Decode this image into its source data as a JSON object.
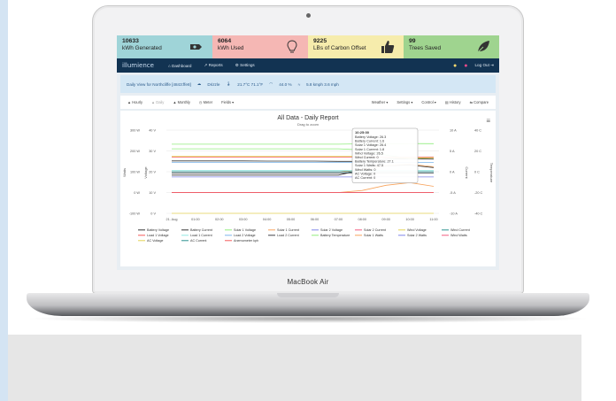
{
  "stats": [
    {
      "value": "10633",
      "label": "kWh Generated",
      "icon": "battery-plug-icon",
      "color": "#9fd4d8"
    },
    {
      "value": "6064",
      "label": "kWh Used",
      "icon": "lightbulb-icon",
      "color": "#f5b7b4"
    },
    {
      "value": "9225",
      "label": "LBs of Carbon Offset",
      "icon": "thumbs-up-icon",
      "color": "#f6ecac"
    },
    {
      "value": "99",
      "label": "Trees Saved",
      "icon": "leaf-icon",
      "color": "#9fd48f"
    }
  ],
  "nav": {
    "logo": "illumience",
    "links": [
      "Dashboard",
      "Reports",
      "Settings"
    ],
    "logout": "Log Out"
  },
  "weather": {
    "view": "Daily View for Northcliffe [4843:ffe8]",
    "condition": "Drizzle",
    "temp": "21.7°C 71.1°F",
    "humidity": "44.0 %",
    "wind": "5.8 kmph 3.6 mph"
  },
  "toolbar": {
    "left": [
      "Hourly",
      "Daily",
      "Monthly",
      "Meter",
      "Fields"
    ],
    "right": [
      "Weather",
      "Settings",
      "Control",
      "History",
      "Compare"
    ]
  },
  "chart_data": {
    "type": "line",
    "title": "All Data - Daily Report",
    "subtitle": "Drag to zoom",
    "x_ticks": [
      "21. Aug",
      "01:00",
      "02:00",
      "03:00",
      "04:00",
      "05:00",
      "06:00",
      "07:00",
      "08:00",
      "09:00",
      "10:00",
      "11:00"
    ],
    "y_axes": {
      "watts": {
        "label": "Watts",
        "ticks": [
          "300 W",
          "200 W",
          "100 W",
          "0 W",
          "-100 W"
        ],
        "range": [
          -100,
          300
        ]
      },
      "voltage": {
        "label": "Voltage",
        "ticks": [
          "40 V",
          "30 V",
          "20 V",
          "10 V",
          "0 V"
        ],
        "range": [
          0,
          40
        ]
      },
      "current": {
        "label": "Current",
        "ticks": [
          "10 A",
          "5 A",
          "0 A",
          "-5 A",
          "-10 A"
        ],
        "range": [
          -10,
          10
        ]
      },
      "temperature": {
        "label": "Temperature",
        "ticks": [
          "40 C",
          "20 C",
          "0 C",
          "-20 C",
          "-40 C"
        ],
        "range": [
          -40,
          40
        ]
      }
    },
    "series": [
      {
        "name": "Battery Voltage",
        "color": "#333333",
        "axis": "voltage",
        "values": [
          25.2,
          25.2,
          25.2,
          25.2,
          25.1,
          25.1,
          25.1,
          25.0,
          25.0,
          26.0,
          26.3,
          26.1
        ]
      },
      {
        "name": "Battery Current",
        "color": "#333333",
        "axis": "current",
        "values": [
          -0.8,
          -0.8,
          -0.8,
          -0.8,
          -0.8,
          -0.8,
          -0.8,
          -0.8,
          0.5,
          1.4,
          1.6,
          1.0
        ]
      },
      {
        "name": "Solar 1 Voltage",
        "color": "#90ed7d",
        "axis": "voltage",
        "values": [
          31.0,
          31.0,
          31.0,
          31.0,
          31.0,
          31.0,
          31.0,
          31.0,
          30.5,
          28.0,
          26.4,
          27.0
        ]
      },
      {
        "name": "Solar 1 Current",
        "color": "#f7a35c",
        "axis": "current",
        "values": [
          0,
          0,
          0,
          0,
          0,
          0,
          0,
          0,
          0.5,
          1.5,
          1.8,
          1.2
        ]
      },
      {
        "name": "Solar 2 Voltage",
        "color": "#8085e9",
        "axis": "voltage",
        "values": [
          17.5,
          17.5,
          17.5,
          17.5,
          17.5,
          17.5,
          17.5,
          17.5,
          17.5,
          17.5,
          17.5,
          17.5
        ]
      },
      {
        "name": "Solar 2 Current",
        "color": "#f15c80",
        "axis": "current",
        "values": [
          0,
          0,
          0,
          0,
          0,
          0,
          0,
          0,
          0,
          0,
          0,
          0
        ]
      },
      {
        "name": "Wind Voltage",
        "color": "#e4d354",
        "axis": "voltage",
        "values": [
          27.5,
          27.5,
          27.5,
          27.5,
          27.5,
          27.5,
          27.5,
          27.5,
          27.5,
          26.8,
          26.5,
          26.6
        ]
      },
      {
        "name": "Wind Current",
        "color": "#2b908f",
        "axis": "current",
        "values": [
          0,
          0,
          0,
          0,
          0,
          0,
          0,
          0,
          0,
          0,
          0,
          0
        ]
      },
      {
        "name": "Load 1 Voltage",
        "color": "#f45b5b",
        "axis": "voltage",
        "values": [
          27.0,
          27.0,
          27.0,
          27.0,
          27.0,
          27.0,
          27.0,
          27.0,
          27.0,
          27.0,
          27.0,
          27.0
        ]
      },
      {
        "name": "Load 1 Current",
        "color": "#91e8e1",
        "axis": "current",
        "values": [
          0.3,
          0.3,
          0.3,
          0.3,
          0.3,
          0.3,
          0.3,
          0.3,
          0.3,
          0.3,
          0.3,
          0.3
        ]
      },
      {
        "name": "Load 2 Voltage",
        "color": "#7cb5ec",
        "axis": "voltage",
        "values": [
          24.5,
          24.5,
          24.5,
          24.5,
          24.5,
          24.5,
          24.5,
          24.5,
          24.5,
          24.5,
          24.5,
          24.5
        ]
      },
      {
        "name": "Load 2 Current",
        "color": "#434348",
        "axis": "current",
        "values": [
          -0.3,
          -0.3,
          -0.3,
          -0.3,
          -0.3,
          -0.3,
          -0.3,
          -0.3,
          -0.3,
          -0.3,
          -0.3,
          -0.3
        ]
      },
      {
        "name": "Battery Temperature",
        "color": "#90ed7d",
        "axis": "temperature",
        "values": [
          26.5,
          26.5,
          26.5,
          26.5,
          26.5,
          26.5,
          26.5,
          26.5,
          26.8,
          27.0,
          27.1,
          27.0
        ]
      },
      {
        "name": "Solar 1 Watts",
        "color": "#f7a35c",
        "axis": "watts",
        "values": [
          0,
          0,
          0,
          0,
          0,
          0,
          0,
          0,
          10,
          35,
          47.5,
          30
        ]
      },
      {
        "name": "Solar 2 Watts",
        "color": "#8085e9",
        "axis": "watts",
        "values": [
          0,
          0,
          0,
          0,
          0,
          0,
          0,
          0,
          0,
          0,
          0,
          0
        ]
      },
      {
        "name": "Wind Watts",
        "color": "#f15c80",
        "axis": "watts",
        "values": [
          0,
          0,
          0,
          0,
          0,
          0,
          0,
          0,
          0,
          0,
          0,
          0
        ]
      },
      {
        "name": "AC Voltage",
        "color": "#e4d354",
        "axis": "voltage",
        "values": [
          0,
          0,
          0,
          0,
          0,
          0,
          0,
          0,
          0,
          0,
          0,
          0
        ]
      },
      {
        "name": "AC Current",
        "color": "#2b908f",
        "axis": "current",
        "values": [
          0,
          0,
          0,
          0,
          0,
          0,
          0,
          0,
          0,
          0,
          0,
          0
        ]
      },
      {
        "name": "Anemometer kph",
        "color": "#f45b5b",
        "axis": "watts",
        "values": [
          0,
          0,
          0,
          0,
          0,
          0,
          0,
          0,
          0,
          0,
          0,
          0
        ]
      }
    ],
    "tooltip": {
      "time": "10:25:00",
      "lines": [
        "Battery Voltage: 26.3",
        "Battery Current: 1.6",
        "Solar 1 Voltage: 26.4",
        "Solar 1 Current: 1.8",
        "Wind Voltage: 26.5",
        "Wind Current: 0",
        "Battery Temperature: 27.1",
        "Solar 1 Watts: 47.5",
        "Wind Watts: 0",
        "AC Voltage: 0",
        "AC Current: 0"
      ]
    },
    "legend": {
      "placement": "bottom"
    }
  },
  "device": {
    "brand": "MacBook Air"
  }
}
